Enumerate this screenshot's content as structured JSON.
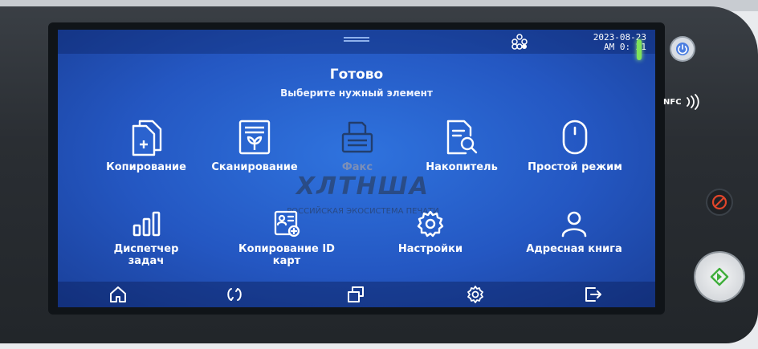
{
  "status": {
    "date": "2023-08-23",
    "time": "AM 0: 21"
  },
  "header": {
    "title": "Готово",
    "subtitle": "Выберите нужный элемент"
  },
  "apps": [
    {
      "label": "Копирование",
      "icon": "copy-icon"
    },
    {
      "label": "Сканирование",
      "icon": "scan-icon"
    },
    {
      "label": "Факс",
      "icon": "fax-icon"
    },
    {
      "label": "Накопитель",
      "icon": "storage-search-icon"
    },
    {
      "label": "Простой режим",
      "icon": "mouse-icon"
    },
    {
      "label": "Диспетчер задач",
      "icon": "bar-chart-icon"
    },
    {
      "label": "Копирование ID карт",
      "icon": "id-card-icon"
    },
    {
      "label": "Настройки",
      "icon": "gear-icon"
    },
    {
      "label": "Адресная книга",
      "icon": "person-icon"
    }
  ],
  "watermark": {
    "logo": "ХЛТНША",
    "text": "РОССИЙСКАЯ ЭКОСИСТЕМА ПЕЧАТИ"
  },
  "device": {
    "nfc_label": "NFC"
  },
  "colors": {
    "screen_blue": "#2457c2",
    "led_green": "#7fe35a",
    "stop_red": "#e0452a",
    "start_green": "#3fae3b"
  }
}
